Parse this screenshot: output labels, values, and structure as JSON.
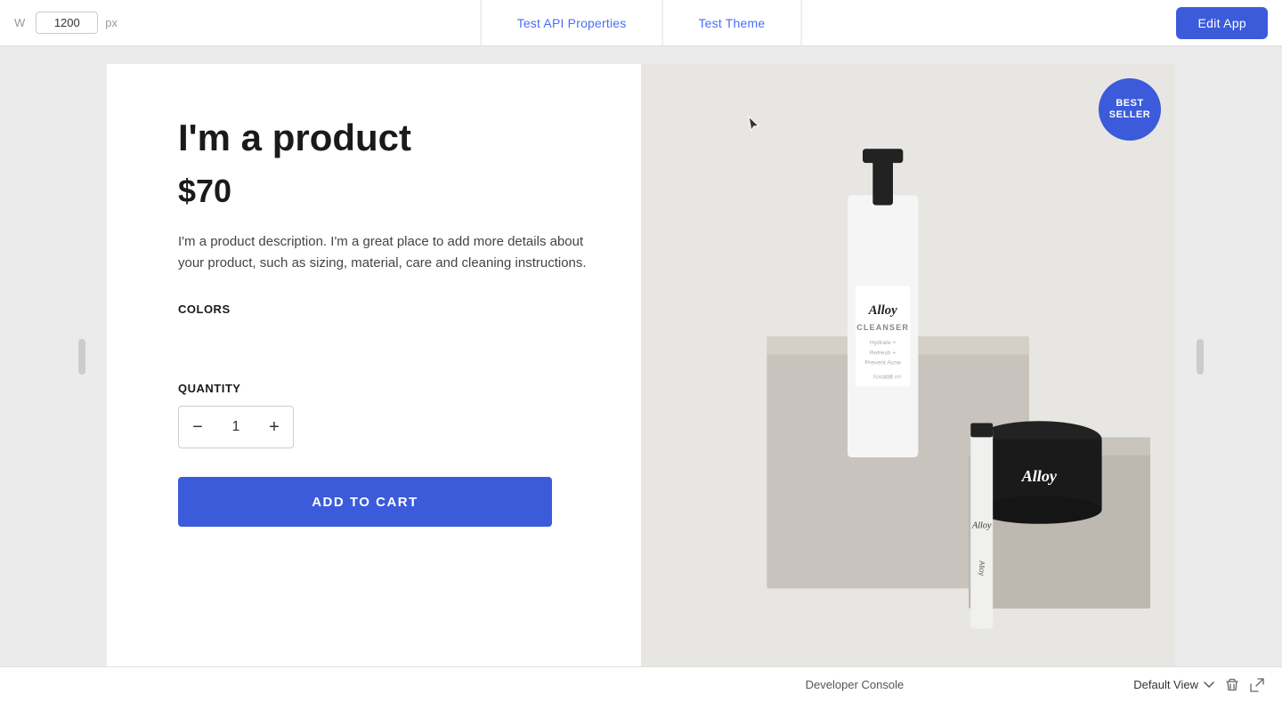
{
  "topbar": {
    "width_label": "W",
    "width_value": "1200",
    "width_unit": "px",
    "tab_api": "Test API Properties",
    "tab_theme": "Test Theme",
    "edit_app": "Edit App"
  },
  "product": {
    "title": "I'm a product",
    "price": "$70",
    "description": "I'm a product description. I'm a great place to add more details about your product, such as sizing, material, care and cleaning instructions.",
    "colors_label": "COLORS",
    "quantity_label": "QUANTITY",
    "quantity_value": "1",
    "qty_minus": "−",
    "qty_plus": "+",
    "add_to_cart": "ADD TO CART",
    "badge_line1": "BEST",
    "badge_line2": "SELLER"
  },
  "bottom": {
    "developer_console": "Developer Console",
    "default_view": "Default View"
  }
}
